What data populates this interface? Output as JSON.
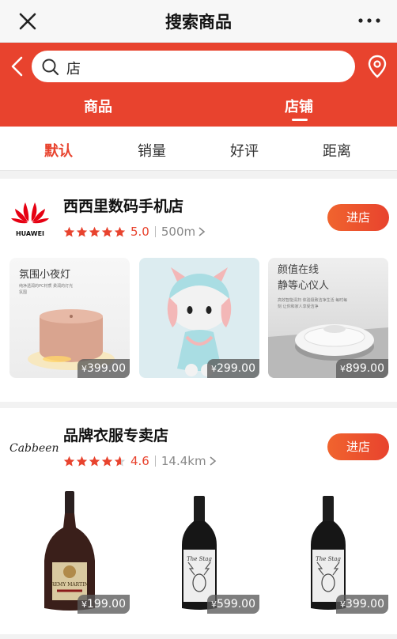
{
  "titlebar": {
    "title": "搜索商品",
    "close_icon": "close-icon",
    "more_icon": "more-dots-icon"
  },
  "header": {
    "search": {
      "value": "店",
      "icon": "search-icon"
    },
    "back_icon": "chevron-left-icon",
    "location_icon": "location-pin-icon",
    "tabs": [
      {
        "label": "商品",
        "active": false
      },
      {
        "label": "店铺",
        "active": true
      }
    ]
  },
  "sort": [
    {
      "label": "默认",
      "active": true
    },
    {
      "label": "销量",
      "active": false
    },
    {
      "label": "好评",
      "active": false
    },
    {
      "label": "距离",
      "active": false
    }
  ],
  "stores": [
    {
      "name": "西西里数码手机店",
      "logo_text": "HUAWEI",
      "rating": "5.0",
      "rating_value": 5.0,
      "distance": "500m",
      "enter_label": "进店",
      "products": [
        {
          "caption": "氛围小夜灯",
          "sub": "纯净透润的PC材质 柔润的灯光氛围",
          "price": "399.00",
          "currency": "¥"
        },
        {
          "caption": "",
          "sub": "",
          "price": "299.00",
          "currency": "¥"
        },
        {
          "caption_line1": "颜值在线",
          "caption_line2": "静等心仪人",
          "sub": "高效智能清扫 体验极致洁净生活 每时每刻 让你和家人享受洁净",
          "price": "899.00",
          "currency": "¥"
        }
      ]
    },
    {
      "name": "品牌衣服专卖店",
      "logo_text": "Cabbeen",
      "rating": "4.6",
      "rating_value": 4.6,
      "distance": "14.4km",
      "enter_label": "进店",
      "products": [
        {
          "price": "199.00",
          "currency": "¥",
          "label_text": "REMY MARTIN"
        },
        {
          "price": "599.00",
          "currency": "¥",
          "label_text": "The Stag"
        },
        {
          "price": "399.00",
          "currency": "¥",
          "label_text": "The Stag"
        }
      ]
    }
  ],
  "colors": {
    "brand_red": "#e8432e",
    "star_red": "#e8432e",
    "star_empty": "#d0d0d0"
  }
}
